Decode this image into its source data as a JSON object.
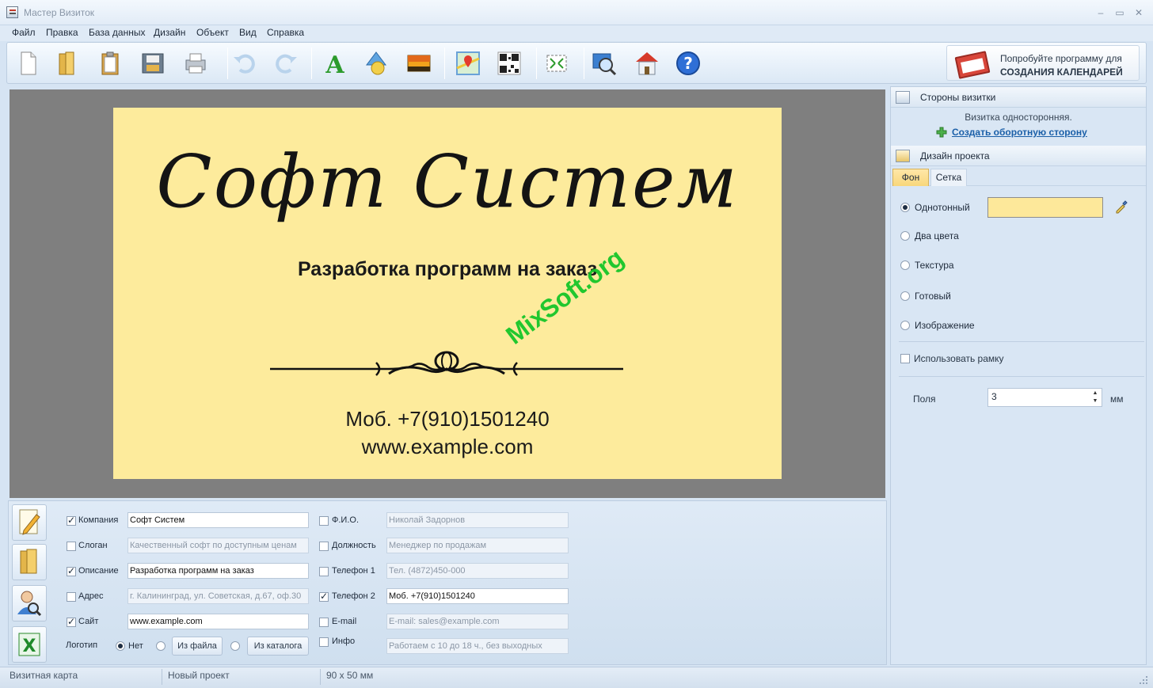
{
  "window": {
    "title": "Мастер Визиток",
    "minimize": "–",
    "maximize": "▭",
    "close": "✕"
  },
  "menu": [
    "Файл",
    "Правка",
    "База данных",
    "Дизайн",
    "Объект",
    "Вид",
    "Справка"
  ],
  "toolbar": {
    "buttons": [
      "new-icon",
      "open-icon",
      "paste-icon",
      "save-icon",
      "print-icon",
      "undo-icon",
      "redo-icon",
      "text-icon",
      "shapes-icon",
      "image-icon",
      "map-icon",
      "qrcode-icon",
      "fit-icon",
      "preview-icon",
      "home-icon",
      "help-icon"
    ],
    "promo_line1": "Попробуйте программу для",
    "promo_line2": "СОЗДАНИЯ КАЛЕНДАРЕЙ"
  },
  "card": {
    "company": "Софт  Систем",
    "description": "Разработка программ на заказ",
    "phone": "Моб. +7(910)1501240",
    "site": "www.example.com",
    "background": "#fdeb9c"
  },
  "watermark": "MixSoft.org",
  "fields": {
    "left": [
      {
        "label": "Компания",
        "value": "Софт Систем",
        "checked": true
      },
      {
        "label": "Слоган",
        "value": "Качественный софт по доступным ценам",
        "checked": false
      },
      {
        "label": "Описание",
        "value": "Разработка программ на заказ",
        "checked": true
      },
      {
        "label": "Адрес",
        "value": "г. Калининград, ул. Советская, д.67, оф.30",
        "checked": false
      },
      {
        "label": "Сайт",
        "value": "www.example.com",
        "checked": true
      }
    ],
    "right": [
      {
        "label": "Ф.И.О.",
        "value": "Николай Задорнов",
        "checked": false
      },
      {
        "label": "Должность",
        "value": "Менеджер по продажам",
        "checked": false
      },
      {
        "label": "Телефон 1",
        "value": "Тел. (4872)450-000",
        "checked": false
      },
      {
        "label": "Телефон 2",
        "value": "Моб. +7(910)1501240",
        "checked": true
      },
      {
        "label": "E-mail",
        "value": "E-mail: sales@example.com",
        "checked": false
      },
      {
        "label": "Инфо",
        "value": "Работаем с 10 до 18 ч., без выходных",
        "checked": false
      }
    ],
    "logo_label": "Логотип",
    "logo_none": "Нет",
    "logo_from_file": "Из файла",
    "logo_from_catalog": "Из каталога"
  },
  "right_panel": {
    "sides_header": "Стороны визитки",
    "sides_info": "Визитка односторонняя.",
    "create_back": "Создать оборотную сторону",
    "design_header": "Дизайн проекта",
    "tabs": [
      "Фон",
      "Сетка"
    ],
    "bg_options": [
      "Однотонный",
      "Два цвета",
      "Текстура",
      "Готовый",
      "Изображение"
    ],
    "selected_option": "Однотонный",
    "swatch_color": "#fde89a",
    "use_frame": "Использовать рамку",
    "margins_label": "Поля",
    "margins_value": "3",
    "margins_unit": "мм"
  },
  "status": {
    "type": "Визитная карта",
    "project": "Новый проект",
    "size": "90 x 50 мм"
  }
}
